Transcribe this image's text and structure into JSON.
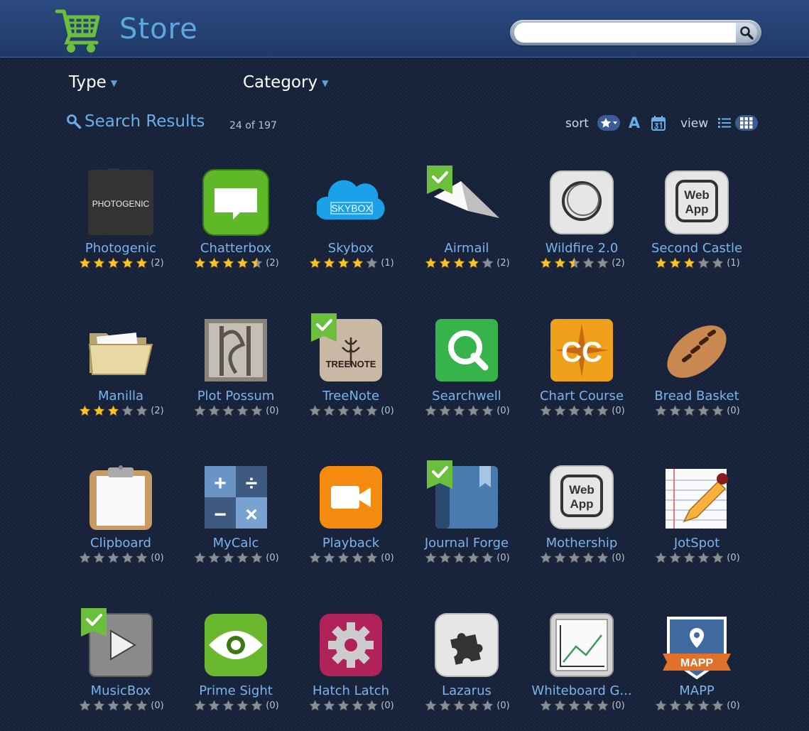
{
  "header": {
    "title": "Store",
    "search_placeholder": "",
    "search_value": ""
  },
  "filters": {
    "type_label": "Type",
    "category_label": "Category"
  },
  "results": {
    "title": "Search Results",
    "count": "24 of 197"
  },
  "toolbar": {
    "sort_label": "sort",
    "sort_alpha_glyph": "A",
    "view_label": "view"
  },
  "colors": {
    "accent": "#6aaee8",
    "star_gold": "#f6c22e",
    "star_grey": "#8a8f96",
    "installed": "#6cbf3c"
  },
  "apps": [
    {
      "name": "Photogenic",
      "rating": 5,
      "count": "(2)",
      "icon": "photogenic-icon",
      "installed": false
    },
    {
      "name": "Chatterbox",
      "rating": 4.5,
      "count": "(2)",
      "icon": "chat-bubble-icon",
      "installed": false
    },
    {
      "name": "Skybox",
      "rating": 4,
      "count": "(1)",
      "icon": "cloud-icon",
      "installed": false
    },
    {
      "name": "Airmail",
      "rating": 4,
      "count": "(2)",
      "icon": "paper-plane-icon",
      "installed": true
    },
    {
      "name": "Wildfire 2.0",
      "rating": 2.5,
      "count": "(2)",
      "icon": "circle-swirl-icon",
      "installed": false
    },
    {
      "name": "Second Castle",
      "rating": 3,
      "count": "(1)",
      "icon": "web-app-icon",
      "installed": false
    },
    {
      "name": "Manilla",
      "rating": 3,
      "count": "(2)",
      "icon": "folder-icon",
      "installed": false
    },
    {
      "name": "Plot Possum",
      "rating": 0,
      "count": "(0)",
      "icon": "plot-possum-icon",
      "installed": false
    },
    {
      "name": "TreeNote",
      "rating": 0,
      "count": "(0)",
      "icon": "tree-note-icon",
      "installed": true
    },
    {
      "name": "Searchwell",
      "rating": 0,
      "count": "(0)",
      "icon": "search-q-icon",
      "installed": false
    },
    {
      "name": "Chart Course",
      "rating": 0,
      "count": "(0)",
      "icon": "chart-course-icon",
      "installed": false
    },
    {
      "name": "Bread Basket",
      "rating": 0,
      "count": "(0)",
      "icon": "bread-icon",
      "installed": false
    },
    {
      "name": "Clipboard",
      "rating": 0,
      "count": "(0)",
      "icon": "clipboard-icon",
      "installed": false
    },
    {
      "name": "MyCalc",
      "rating": 0,
      "count": "(0)",
      "icon": "calculator-icon",
      "installed": false
    },
    {
      "name": "Playback",
      "rating": 0,
      "count": "(0)",
      "icon": "video-camera-icon",
      "installed": false
    },
    {
      "name": "Journal Forge",
      "rating": 0,
      "count": "(0)",
      "icon": "journal-icon",
      "installed": true
    },
    {
      "name": "Mothership",
      "rating": 0,
      "count": "(0)",
      "icon": "web-app-icon",
      "installed": false
    },
    {
      "name": "JotSpot",
      "rating": 0,
      "count": "(0)",
      "icon": "notepad-pencil-icon",
      "installed": false
    },
    {
      "name": "MusicBox",
      "rating": 0,
      "count": "(0)",
      "icon": "play-icon",
      "installed": true
    },
    {
      "name": "Prime Sight",
      "rating": 0,
      "count": "(0)",
      "icon": "eye-icon",
      "installed": false
    },
    {
      "name": "Hatch Latch",
      "rating": 0,
      "count": "(0)",
      "icon": "gear-icon",
      "installed": false
    },
    {
      "name": "Lazarus",
      "rating": 0,
      "count": "(0)",
      "icon": "puzzle-icon",
      "installed": false
    },
    {
      "name": "Whiteboard G...",
      "rating": 0,
      "count": "(0)",
      "icon": "whiteboard-icon",
      "installed": false
    },
    {
      "name": "MAPP",
      "rating": 0,
      "count": "(0)",
      "icon": "map-pin-icon",
      "installed": false
    }
  ]
}
